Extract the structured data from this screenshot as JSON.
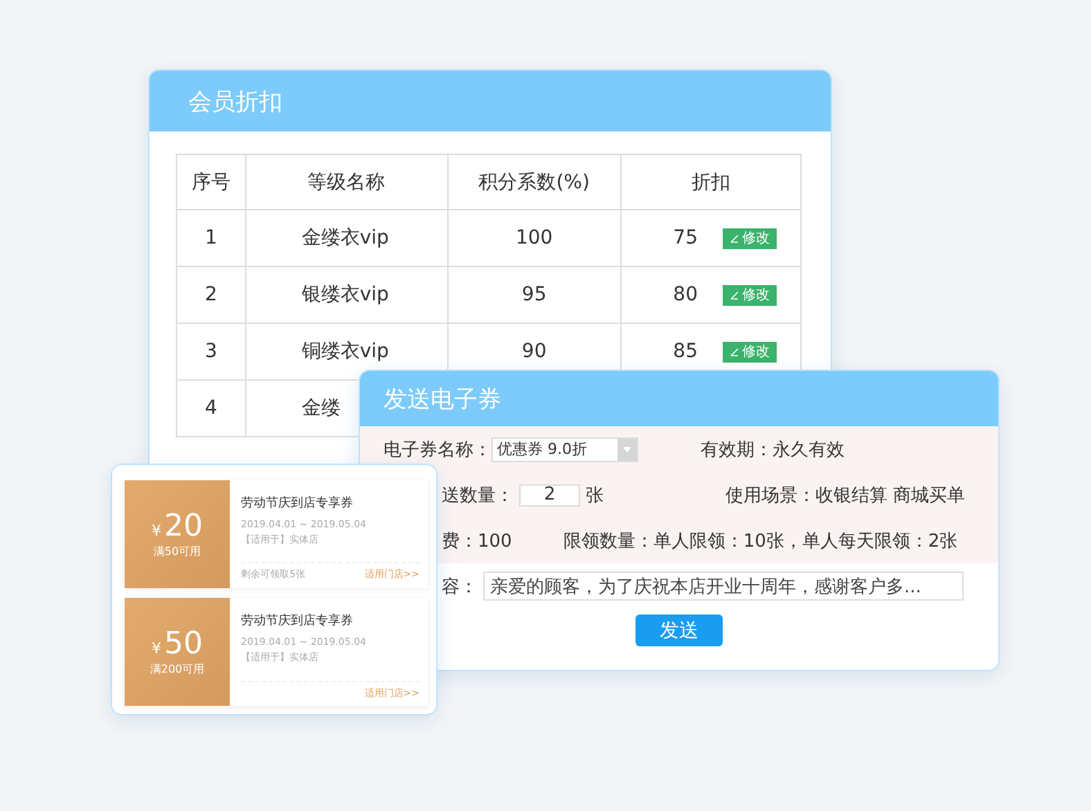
{
  "member_discount": {
    "title": "会员折扣",
    "table": {
      "columns": [
        "序号",
        "等级名称",
        "积分系数(%)",
        "折扣"
      ],
      "rows": [
        {
          "index": "1",
          "name": "金缕衣vip",
          "ratio": "100",
          "discount": "75",
          "action": "修改"
        },
        {
          "index": "2",
          "name": "银缕衣vip",
          "ratio": "95",
          "discount": "80",
          "action": "修改"
        },
        {
          "index": "3",
          "name": "铜缕衣vip",
          "ratio": "90",
          "discount": "85",
          "action": "修改"
        },
        {
          "index": "4",
          "name": "金缕"
        }
      ]
    }
  },
  "send_coupon": {
    "title": "发送电子券",
    "rows": [
      {
        "kind": "select",
        "label": "电子券名称：",
        "value": "优惠券 9.0折",
        "side": "有效期：永久有效"
      },
      {
        "kind": "input",
        "label": "送数量：",
        "value": "2",
        "unit": "张",
        "side": "使用场景：收银结算 商城买单"
      },
      {
        "kind": "text",
        "label": "费：100",
        "side": "限领数量：单人限领：10张，单人每天限领：2张"
      },
      {
        "kind": "content",
        "label": "容：",
        "value": "亲爱的顾客，为了庆祝本店开业十周年，感谢客户多..."
      }
    ],
    "button": "发送"
  },
  "coupons": [
    {
      "currency": "¥",
      "amount": "20",
      "condition": "满50可用",
      "title": "劳动节庆到店专享券",
      "dates": "2019.04.01 ~ 2019.05.04",
      "scope": "【适用于】实体店",
      "remaining": "剩余可领取5张",
      "link": "适用门店>>"
    },
    {
      "currency": "¥",
      "amount": "50",
      "condition": "满200可用",
      "title": "劳动节庆到店专享券",
      "dates": "2019.04.01 ~ 2019.05.04",
      "scope": "【适用于】实体店",
      "link": "适用门店>>"
    }
  ]
}
